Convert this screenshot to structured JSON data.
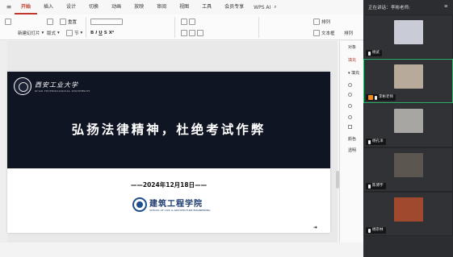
{
  "ribbon": {
    "tabs": [
      "开始",
      "插入",
      "设计",
      "切换",
      "动画",
      "放映",
      "审阅",
      "视图",
      "工具",
      "会员专享"
    ],
    "active_tab": "开始",
    "ai_label": "WPS AI",
    "new_slide_label": "新建幻灯片",
    "layout_label": "版式",
    "section_label": "节",
    "reset_label": "重置",
    "arrange_label": "排列",
    "textbox_label": "文本框",
    "arrange2_label": "排列"
  },
  "properties": {
    "title": "对象",
    "fill_tab": "填充",
    "fill_section": "填充",
    "color_label": "颜色",
    "transparency_label": "透明"
  },
  "slide": {
    "university_name": "西安工业大学",
    "university_en": "XI'AN TECHNOLOGICAL UNIVERSITY",
    "headline": "弘扬法律精神，杜绝考试作弊",
    "date": "——2024年12月18日——",
    "college_name": "建筑工程学院",
    "college_en": "SCHOOL OF CIVIL & ARCHITECTURE ENGINEERING"
  },
  "meeting": {
    "status": "正在讲话：",
    "speaker": "李彬老师;",
    "participants": [
      {
        "name": "杨武",
        "camera_color": "#c9ccd6"
      },
      {
        "name": "李彬老师",
        "camera_color": "#b7aa9b"
      },
      {
        "name": "杨孔洋",
        "camera_color": "#a8a6a3"
      },
      {
        "name": "陈博宇",
        "camera_color": "#5b5650"
      },
      {
        "name": "杨宗林",
        "camera_color": "#a0492f"
      }
    ]
  }
}
